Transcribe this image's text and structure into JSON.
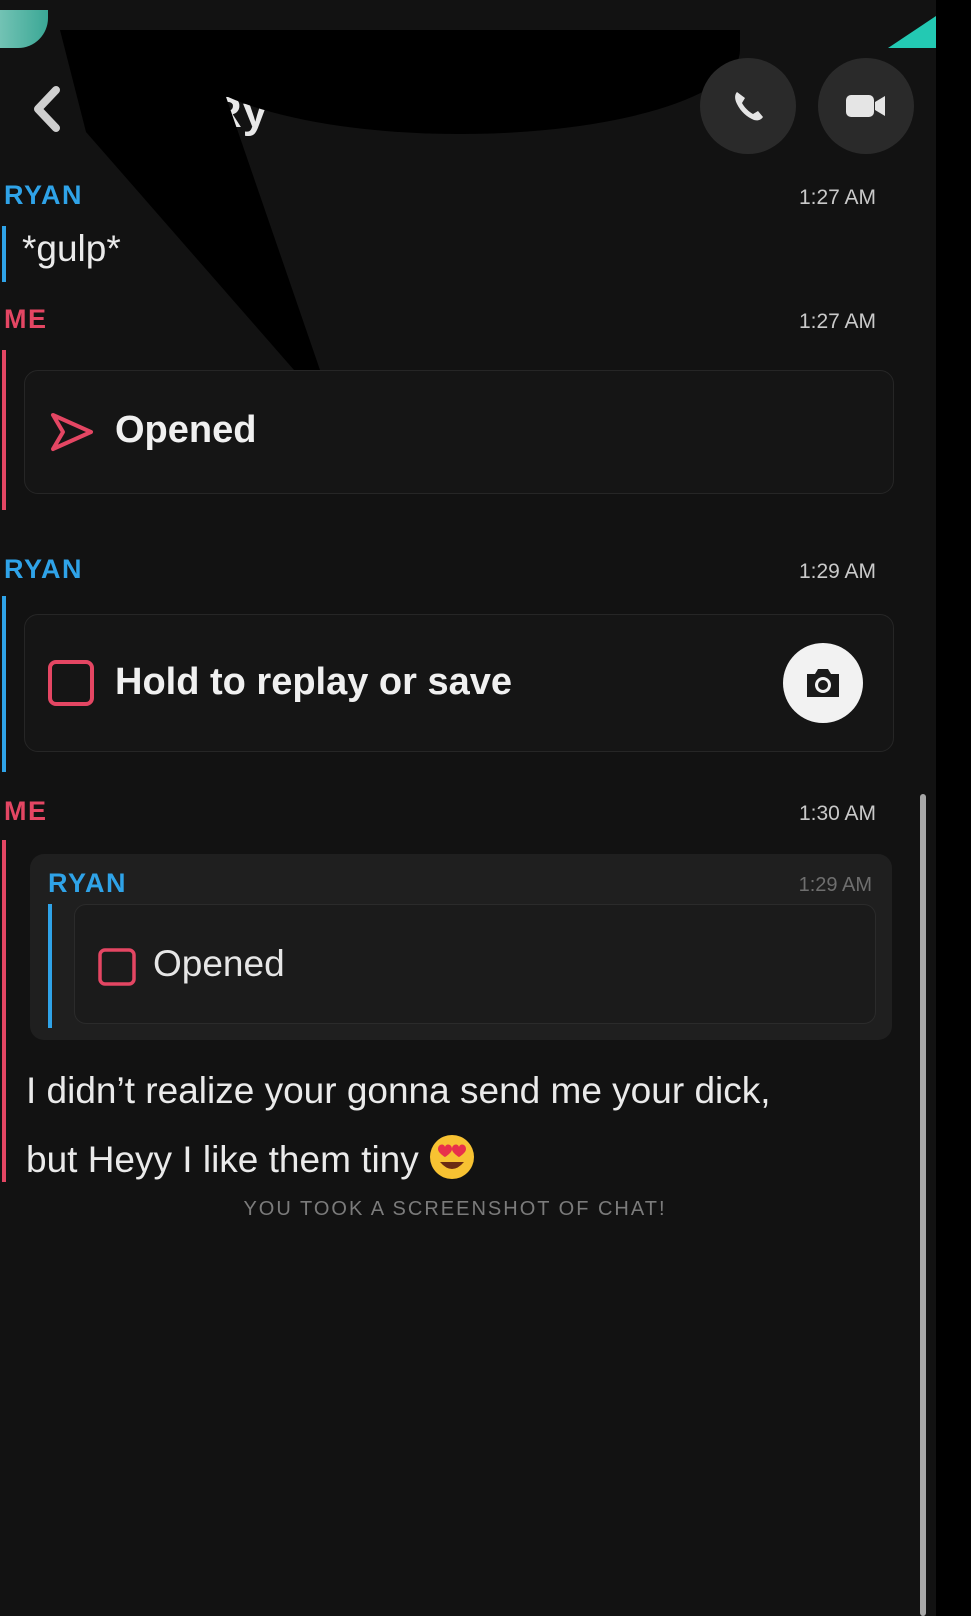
{
  "header": {
    "title": "Ry",
    "back_icon": "chevron-left-icon",
    "call_icon": "phone-icon",
    "video_icon": "video-camera-icon"
  },
  "messages": [
    {
      "sender": "RYAN",
      "time": "1:27 AM",
      "text": "*gulp*"
    },
    {
      "sender": "ME",
      "time": "1:27 AM",
      "snap_status": "Opened",
      "snap_icon": "sent-arrow-icon"
    },
    {
      "sender": "RYAN",
      "time": "1:29 AM",
      "snap_status": "Hold to replay or save",
      "snap_icon": "snap-square-icon",
      "action_icon": "camera-icon"
    },
    {
      "sender": "ME",
      "time": "1:30 AM",
      "quote": {
        "sender": "RYAN",
        "time": "1:29 AM",
        "status": "Opened"
      },
      "text_line1": "I didn’t realize your gonna send me your dick,",
      "text_line2": "but Heyy I like them tiny",
      "emoji": "heart-eyes-emoji"
    }
  ],
  "notice": "YOU TOOK A SCREENSHOT OF CHAT!",
  "colors": {
    "ryan": "#2fa3e8",
    "me": "#e44663",
    "background": "#121212"
  }
}
